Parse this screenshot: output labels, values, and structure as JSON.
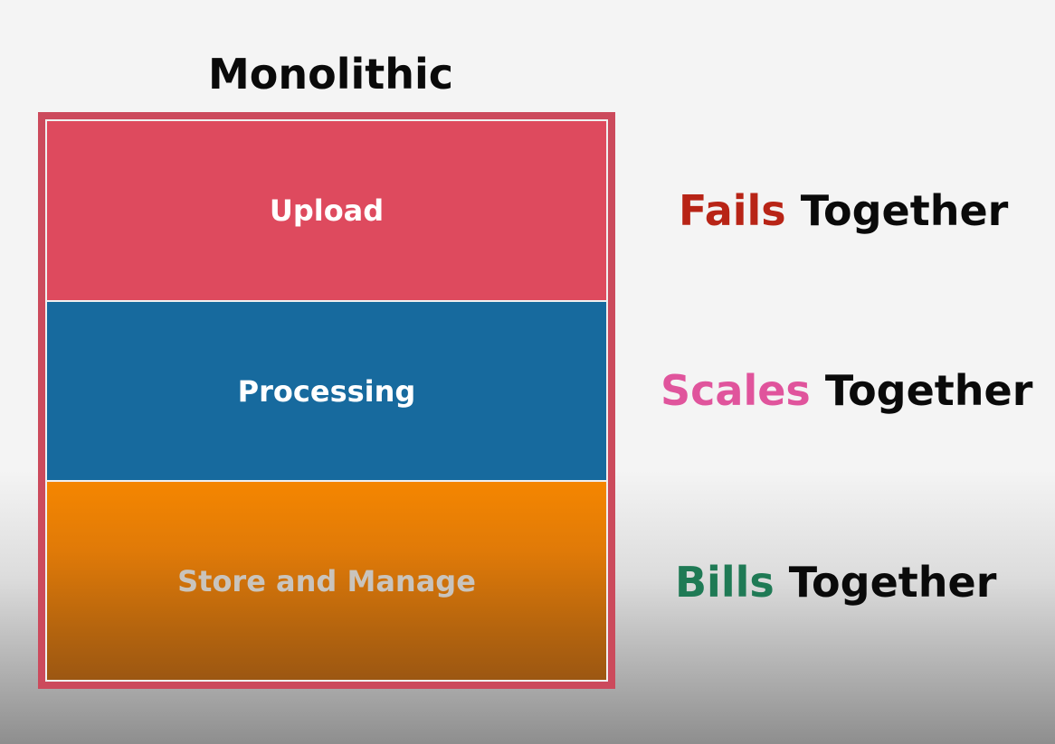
{
  "title": "Monolithic",
  "layers": [
    {
      "label": "Upload"
    },
    {
      "label": "Processing"
    },
    {
      "label": "Store and Manage"
    }
  ],
  "traits": [
    {
      "keyword": "Fails",
      "rest": "Together"
    },
    {
      "keyword": "Scales",
      "rest": "Together"
    },
    {
      "keyword": "Bills",
      "rest": "Together"
    }
  ]
}
